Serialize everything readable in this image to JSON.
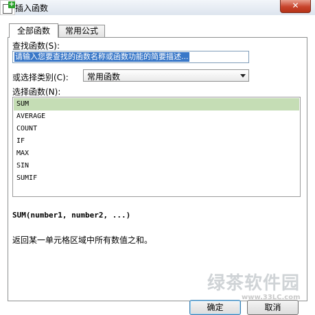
{
  "window": {
    "title": "插入函数",
    "close_label": "✕"
  },
  "tabs": [
    {
      "label": "全部函数",
      "active": true
    },
    {
      "label": "常用公式",
      "active": false
    }
  ],
  "search": {
    "label": "查找函数(S):",
    "value": "请输入您要查找的函数名称或函数功能的简要描述..."
  },
  "category": {
    "label": "或选择类别(C):",
    "selected": "常用函数"
  },
  "function_list": {
    "label": "选择函数(N):",
    "items": [
      "SUM",
      "AVERAGE",
      "COUNT",
      "IF",
      "MAX",
      "SIN",
      "SUMIF"
    ],
    "selected_index": 0
  },
  "signature": "SUM(number1, number2, ...)",
  "description": "返回某一单元格区域中所有数值之和。",
  "buttons": {
    "ok": "确定",
    "cancel": "取消"
  },
  "watermark": {
    "text": "绿茶软件园",
    "url": "www.33LC.com"
  },
  "colors": {
    "selection": "#3a78c8",
    "list_highlight": "#c5ddb5",
    "close": "#c8442c"
  }
}
